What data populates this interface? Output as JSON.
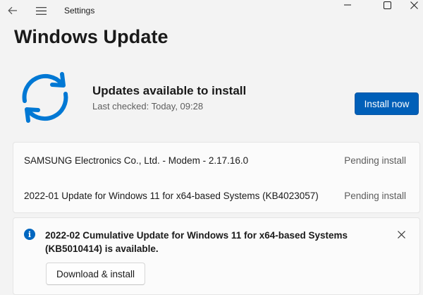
{
  "app": {
    "title": "Settings"
  },
  "page": {
    "title": "Windows Update"
  },
  "status": {
    "title": "Updates available to install",
    "last_checked": "Last checked: Today, 09:28",
    "install_label": "Install now",
    "icon": "sync-icon"
  },
  "updates": [
    {
      "name": "SAMSUNG Electronics Co., Ltd.  - Modem - 2.17.16.0",
      "status": "Pending install"
    },
    {
      "name": "2022-01 Update for Windows 11 for x64-based Systems (KB4023057)",
      "status": "Pending install"
    }
  ],
  "notice": {
    "text": "2022-02 Cumulative Update for Windows 11 for x64-based Systems (KB5010414) is available.",
    "action_label": "Download & install",
    "icon": "info-icon"
  },
  "colors": {
    "accent": "#005fb8",
    "icon_blue": "#0078d4",
    "background": "#f3f3f3"
  }
}
